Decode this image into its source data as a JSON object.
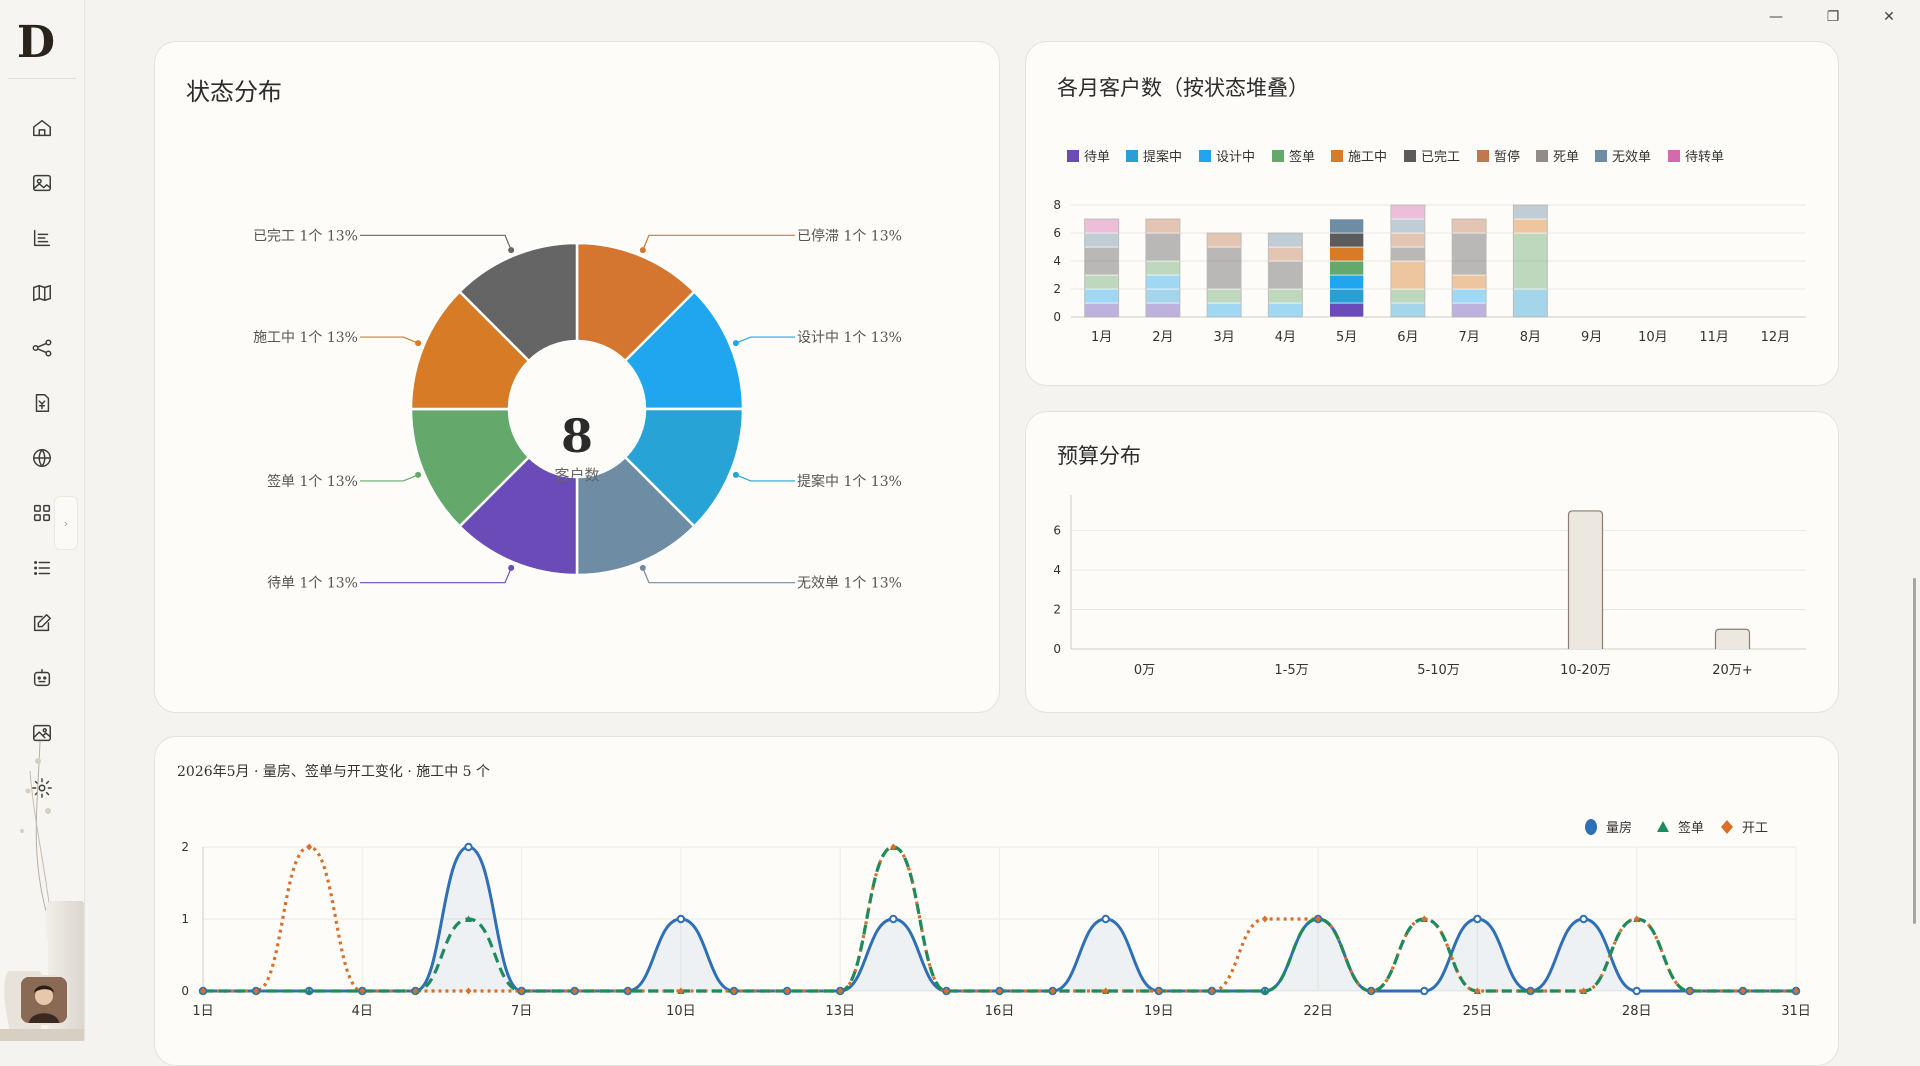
{
  "window": {
    "minimize": "—",
    "restore": "❐",
    "close": "✕"
  },
  "sidebar": {
    "logo": "D",
    "expand": "›",
    "items": [
      {
        "name": "home-icon"
      },
      {
        "name": "gallery-icon"
      },
      {
        "name": "list-tree-icon"
      },
      {
        "name": "map-icon"
      },
      {
        "name": "flow-icon"
      },
      {
        "name": "invoice-icon"
      },
      {
        "name": "globe-icon"
      },
      {
        "name": "apps-icon"
      },
      {
        "name": "list-icon"
      },
      {
        "name": "edit-icon"
      },
      {
        "name": "robot-icon"
      },
      {
        "name": "image-icon"
      },
      {
        "name": "settings-icon"
      }
    ]
  },
  "status_card": {
    "title": "状态分布",
    "center_value": "8",
    "center_label": "客户数"
  },
  "monthly_card": {
    "title": "各月客户数（按状态堆叠）"
  },
  "budget_card": {
    "title": "预算分布"
  },
  "trend_card": {
    "header": "2026年5月 · 量房、签单与开工变化 · 施工中 5 个"
  },
  "chart_data": [
    {
      "type": "pie",
      "slices": [
        {
          "label": "已停滞 1个 13%",
          "value": 1,
          "color": "#d4762f"
        },
        {
          "label": "设计中 1个 13%",
          "value": 1,
          "color": "#1fa6ef"
        },
        {
          "label": "提案中 1个 13%",
          "value": 1,
          "color": "#27a3d6"
        },
        {
          "label": "无效单 1个 13%",
          "value": 1,
          "color": "#6e8ca4"
        },
        {
          "label": "待单 1个 13%",
          "value": 1,
          "color": "#6a4bb8"
        },
        {
          "label": "签单 1个 13%",
          "value": 1,
          "color": "#65a86c"
        },
        {
          "label": "施工中 1个 13%",
          "value": 1,
          "color": "#d77b27"
        },
        {
          "label": "已完工 1个 13%",
          "value": 1,
          "color": "#656565"
        }
      ]
    },
    {
      "type": "bar",
      "stacked": true,
      "categories": [
        "1月",
        "2月",
        "3月",
        "4月",
        "5月",
        "6月",
        "7月",
        "8月",
        "9月",
        "10月",
        "11月",
        "12月"
      ],
      "yticks": [
        "0",
        "2",
        "4",
        "6",
        "8"
      ],
      "ylim": [
        0,
        8
      ],
      "legend_position": "top",
      "highlight_category": "5月",
      "series": [
        {
          "name": "待单",
          "color": "#6a4bb8",
          "values": [
            1,
            1,
            0,
            0,
            1,
            0,
            1,
            0,
            0,
            0,
            0,
            0
          ]
        },
        {
          "name": "提案中",
          "color": "#2a9fd6",
          "values": [
            0,
            1,
            0,
            0,
            1,
            1,
            0,
            2,
            0,
            0,
            0,
            0
          ]
        },
        {
          "name": "设计中",
          "color": "#1fa6ef",
          "values": [
            1,
            1,
            1,
            1,
            1,
            0,
            1,
            0,
            0,
            0,
            0,
            0
          ]
        },
        {
          "name": "签单",
          "color": "#65a86c",
          "values": [
            1,
            1,
            1,
            1,
            1,
            1,
            0,
            4,
            0,
            0,
            0,
            0
          ]
        },
        {
          "name": "施工中",
          "color": "#d77b27",
          "values": [
            0,
            0,
            0,
            0,
            1,
            2,
            1,
            1,
            0,
            0,
            0,
            0
          ]
        },
        {
          "name": "已完工",
          "color": "#5b5b5b",
          "values": [
            2,
            2,
            3,
            2,
            1,
            1,
            3,
            0,
            0,
            0,
            0,
            0
          ]
        },
        {
          "name": "暂停",
          "color": "#c07850",
          "values": [
            0,
            1,
            1,
            1,
            0,
            1,
            1,
            0,
            0,
            0,
            0,
            0
          ]
        },
        {
          "name": "死单",
          "color": "#928c86",
          "values": [
            0,
            0,
            0,
            0,
            0,
            0,
            0,
            0,
            0,
            0,
            0,
            0
          ]
        },
        {
          "name": "无效单",
          "color": "#6e8ca4",
          "values": [
            1,
            0,
            0,
            1,
            1,
            1,
            0,
            1,
            0,
            0,
            0,
            0
          ]
        },
        {
          "name": "待转单",
          "color": "#d46aae",
          "values": [
            1,
            0,
            0,
            0,
            0,
            1,
            0,
            0,
            0,
            0,
            0,
            0
          ]
        }
      ]
    },
    {
      "type": "bar",
      "categories": [
        "0万",
        "1-5万",
        "5-10万",
        "10-20万",
        "20万+"
      ],
      "values": [
        0,
        0,
        0,
        7,
        1
      ],
      "yticks": [
        "0",
        "2",
        "4",
        "6"
      ],
      "ylim": [
        0,
        7.2
      ],
      "bar_color": "#ece7df",
      "bar_border": "#8b7d72"
    },
    {
      "type": "line",
      "xticks": [
        "1日",
        "4日",
        "7日",
        "10日",
        "13日",
        "16日",
        "19日",
        "22日",
        "25日",
        "28日",
        "31日"
      ],
      "yticks": [
        "0",
        "1",
        "2"
      ],
      "ylim": [
        0,
        2
      ],
      "legend_position": "top-right",
      "series": [
        {
          "name": "量房",
          "color": "#2f6fb5",
          "marker": "circle",
          "values": [
            0,
            0,
            0,
            0,
            0,
            2,
            0,
            0,
            0,
            1,
            0,
            0,
            0,
            1,
            0,
            0,
            0,
            1,
            0,
            0,
            0,
            1,
            0,
            0,
            1,
            0,
            1,
            0,
            0,
            0,
            0
          ]
        },
        {
          "name": "签单",
          "color": "#1f8a5b",
          "marker": "triangle",
          "values": [
            0,
            0,
            0,
            0,
            0,
            1,
            0,
            0,
            0,
            0,
            0,
            0,
            0,
            2,
            0,
            0,
            0,
            0,
            0,
            0,
            0,
            1,
            0,
            1,
            0,
            0,
            0,
            1,
            0,
            0,
            0
          ]
        },
        {
          "name": "开工",
          "color": "#d9702a",
          "marker": "diamond",
          "values": [
            0,
            0,
            2,
            0,
            0,
            0,
            0,
            0,
            0,
            0,
            0,
            0,
            0,
            2,
            0,
            0,
            0,
            0,
            0,
            0,
            1,
            1,
            0,
            1,
            0,
            0,
            0,
            1,
            0,
            0,
            0
          ]
        }
      ]
    }
  ]
}
